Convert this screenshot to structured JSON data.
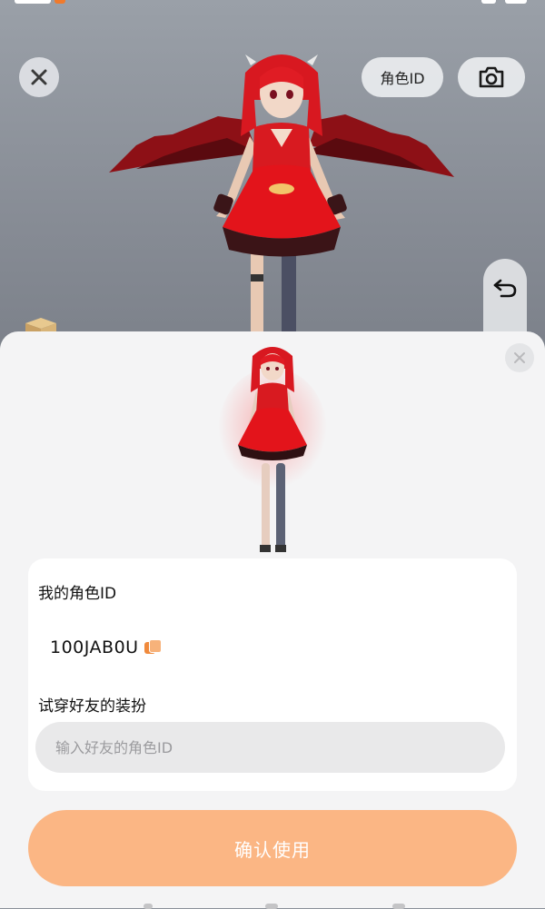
{
  "top_bar": {
    "role_id_button_label": "角色ID"
  },
  "icons": {
    "close": "close-icon",
    "camera": "camera-icon",
    "undo": "undo-icon",
    "sheet_close": "close-icon",
    "copy": "copy-icon",
    "box": "box-icon"
  },
  "panel": {
    "my_id_label": "我的角色ID",
    "my_id_value": "100JAB0U",
    "try_friend_label": "试穿好友的装扮",
    "friend_id_placeholder": "输入好友的角色ID",
    "friend_id_value": "",
    "confirm_label": "确认使用"
  },
  "colors": {
    "accent": "#fbb684",
    "copy_icon": "#f08a3c",
    "dress_red": "#e0141c",
    "wing": "#7a0d12"
  }
}
